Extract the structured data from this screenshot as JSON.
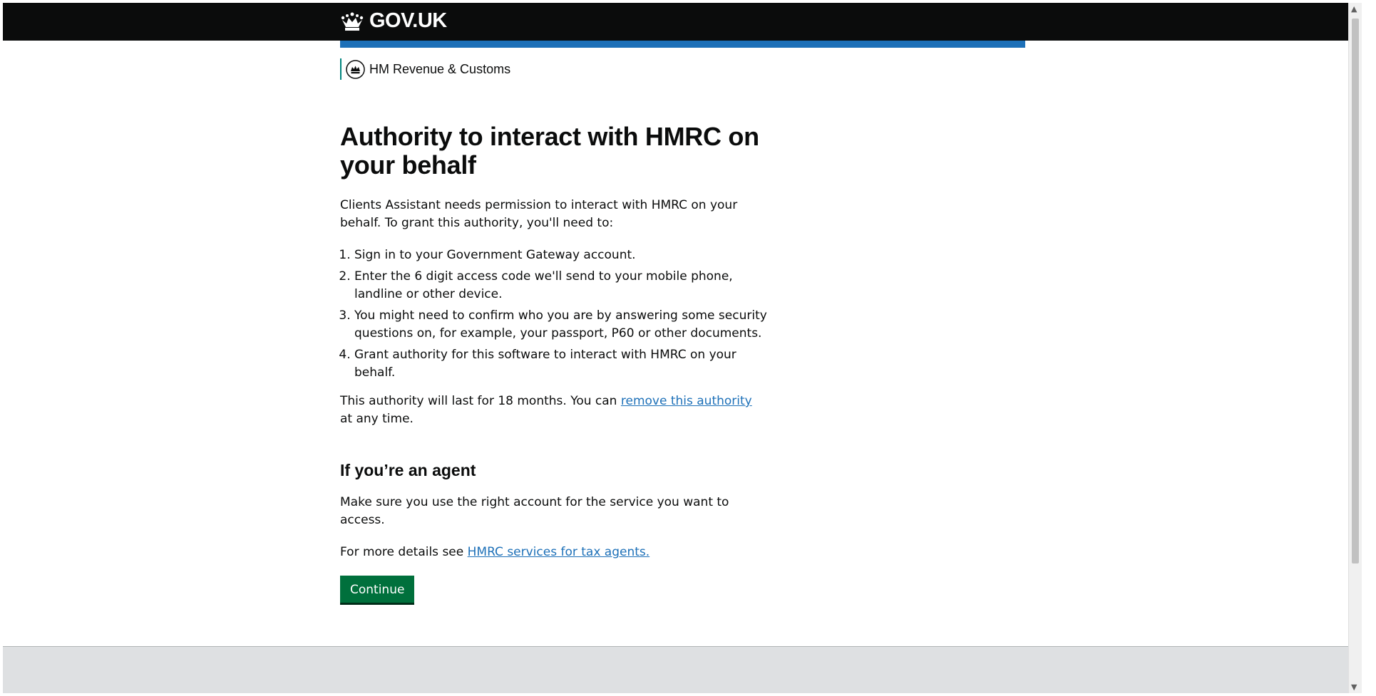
{
  "header": {
    "logo_text": "GOV.UK",
    "logo_icon": "crown-icon"
  },
  "organisation": {
    "name": "HM Revenue & Customs",
    "icon": "hmrc-crest-icon"
  },
  "main": {
    "title": "Authority to interact with HMRC on your behalf",
    "intro": "Clients Assistant needs permission to interact with HMRC on your behalf. To grant this authority, you'll need to:",
    "steps": [
      "Sign in to your Government Gateway account.",
      "Enter the 6 digit access code we'll send to your mobile phone, landline or other device.",
      "You might need to confirm who you are by answering some security questions on, for example, your passport, P60 or other documents.",
      "Grant authority for this software to interact with HMRC on your behalf."
    ],
    "duration_prefix": "This authority will last for 18 months. You can ",
    "duration_link": "remove this authority",
    "duration_suffix": " at any time.",
    "agent_heading": "If you’re an agent",
    "agent_text": "Make sure you use the right account for the service you want to access.",
    "details_prefix": "For more details see ",
    "details_link": "HMRC services for tax agents.",
    "continue_label": "Continue"
  },
  "colors": {
    "header_bg": "#0b0c0c",
    "blue_bar": "#1d70b8",
    "org_border": "#00857e",
    "link": "#1d70b8",
    "button": "#00703c",
    "footer_bg": "#dee0e2"
  }
}
